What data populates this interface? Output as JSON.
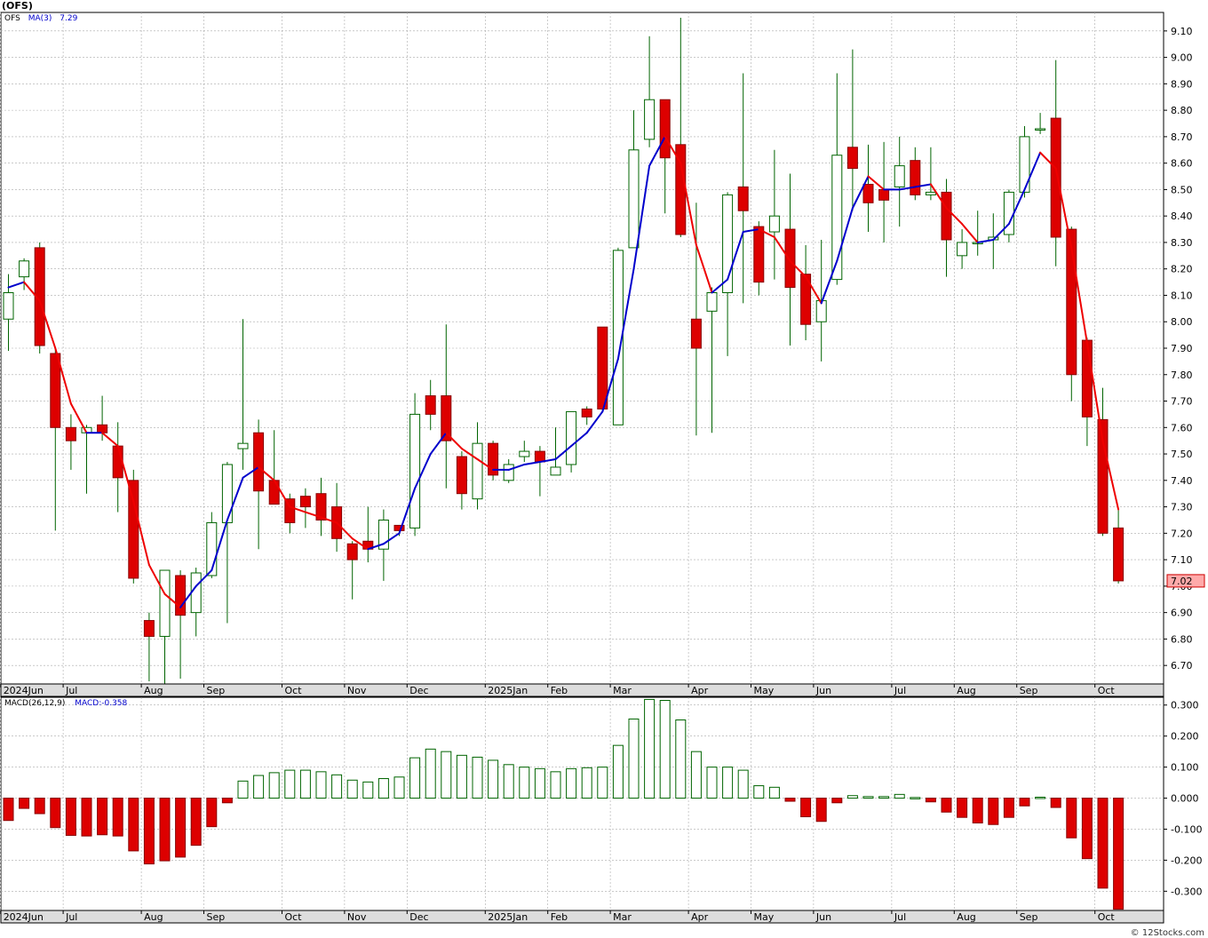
{
  "header": {
    "title": "(OFS)"
  },
  "footer": {
    "credit": "© 12Stocks.com"
  },
  "legends": {
    "price_symbol": "OFS",
    "price_ma_label": "MA(3)",
    "price_ma_value": "7.29",
    "macd_label": "MACD(26,12,9)",
    "macd_value": "MACD:-0.358"
  },
  "colors": {
    "up_candle": "#006400",
    "down_candle": "#dd0000",
    "ma_up": "#0000cc",
    "ma_down": "#ee0000",
    "grid": "#aaaaaa",
    "axis_band": "#dddddd",
    "last_price_box": "#ffaaaa"
  },
  "chart_data": [
    {
      "type": "candlestick",
      "ylim": [
        6.63,
        9.17
      ],
      "yticks": [
        "6.70",
        "6.80",
        "6.90",
        "7.00",
        "7.10",
        "7.20",
        "7.30",
        "7.40",
        "7.50",
        "7.60",
        "7.70",
        "7.80",
        "7.90",
        "8.00",
        "8.10",
        "8.20",
        "8.30",
        "8.40",
        "8.50",
        "8.60",
        "8.70",
        "8.80",
        "8.90",
        "9.00",
        "9.10"
      ],
      "last_price": "7.02",
      "month_labels": [
        {
          "label": "2024Jun",
          "week": 0
        },
        {
          "label": "Jul",
          "week": 4
        },
        {
          "label": "Aug",
          "week": 9
        },
        {
          "label": "Sep",
          "week": 13
        },
        {
          "label": "Oct",
          "week": 18
        },
        {
          "label": "Nov",
          "week": 22
        },
        {
          "label": "Dec",
          "week": 26
        },
        {
          "label": "2025Jan",
          "week": 31
        },
        {
          "label": "Feb",
          "week": 35
        },
        {
          "label": "Mar",
          "week": 39
        },
        {
          "label": "Apr",
          "week": 44
        },
        {
          "label": "May",
          "week": 48
        },
        {
          "label": "Jun",
          "week": 52
        },
        {
          "label": "Jul",
          "week": 57
        },
        {
          "label": "Aug",
          "week": 61
        },
        {
          "label": "Sep",
          "week": 65
        },
        {
          "label": "Oct",
          "week": 70
        }
      ],
      "candles": [
        {
          "o": 8.01,
          "h": 8.18,
          "l": 7.89,
          "c": 8.11
        },
        {
          "o": 8.17,
          "h": 8.24,
          "l": 8.12,
          "c": 8.23
        },
        {
          "o": 8.28,
          "h": 8.3,
          "l": 7.88,
          "c": 7.91
        },
        {
          "o": 7.88,
          "h": 7.9,
          "l": 7.21,
          "c": 7.6
        },
        {
          "o": 7.6,
          "h": 7.65,
          "l": 7.44,
          "c": 7.55
        },
        {
          "o": 7.58,
          "h": 7.61,
          "l": 7.35,
          "c": 7.6
        },
        {
          "o": 7.61,
          "h": 7.72,
          "l": 7.55,
          "c": 7.58
        },
        {
          "o": 7.53,
          "h": 7.62,
          "l": 7.28,
          "c": 7.41
        },
        {
          "o": 7.4,
          "h": 7.44,
          "l": 7.01,
          "c": 7.03
        },
        {
          "o": 6.87,
          "h": 6.9,
          "l": 6.64,
          "c": 6.81
        },
        {
          "o": 6.81,
          "h": 7.06,
          "l": 6.63,
          "c": 7.06
        },
        {
          "o": 7.04,
          "h": 7.06,
          "l": 6.65,
          "c": 6.89
        },
        {
          "o": 6.9,
          "h": 7.07,
          "l": 6.81,
          "c": 7.05
        },
        {
          "o": 7.04,
          "h": 7.28,
          "l": 7.03,
          "c": 7.24
        },
        {
          "o": 7.24,
          "h": 7.47,
          "l": 6.86,
          "c": 7.46
        },
        {
          "o": 7.52,
          "h": 8.01,
          "l": 7.44,
          "c": 7.54
        },
        {
          "o": 7.58,
          "h": 7.63,
          "l": 7.14,
          "c": 7.36
        },
        {
          "o": 7.4,
          "h": 7.59,
          "l": 7.31,
          "c": 7.31
        },
        {
          "o": 7.33,
          "h": 7.35,
          "l": 7.2,
          "c": 7.24
        },
        {
          "o": 7.34,
          "h": 7.37,
          "l": 7.22,
          "c": 7.3
        },
        {
          "o": 7.35,
          "h": 7.41,
          "l": 7.19,
          "c": 7.25
        },
        {
          "o": 7.3,
          "h": 7.39,
          "l": 7.13,
          "c": 7.18
        },
        {
          "o": 7.16,
          "h": 7.17,
          "l": 6.95,
          "c": 7.1
        },
        {
          "o": 7.17,
          "h": 7.3,
          "l": 7.09,
          "c": 7.14
        },
        {
          "o": 7.14,
          "h": 7.29,
          "l": 7.02,
          "c": 7.25
        },
        {
          "o": 7.23,
          "h": 7.23,
          "l": 7.19,
          "c": 7.21
        },
        {
          "o": 7.22,
          "h": 7.73,
          "l": 7.19,
          "c": 7.65
        },
        {
          "o": 7.72,
          "h": 7.78,
          "l": 7.59,
          "c": 7.65
        },
        {
          "o": 7.72,
          "h": 7.99,
          "l": 7.37,
          "c": 7.55
        },
        {
          "o": 7.49,
          "h": 7.51,
          "l": 7.29,
          "c": 7.35
        },
        {
          "o": 7.33,
          "h": 7.62,
          "l": 7.29,
          "c": 7.54
        },
        {
          "o": 7.54,
          "h": 7.55,
          "l": 7.4,
          "c": 7.42
        },
        {
          "o": 7.4,
          "h": 7.48,
          "l": 7.39,
          "c": 7.46
        },
        {
          "o": 7.49,
          "h": 7.55,
          "l": 7.47,
          "c": 7.51
        },
        {
          "o": 7.51,
          "h": 7.53,
          "l": 7.34,
          "c": 7.47
        },
        {
          "o": 7.42,
          "h": 7.6,
          "l": 7.42,
          "c": 7.45
        },
        {
          "o": 7.46,
          "h": 7.66,
          "l": 7.43,
          "c": 7.66
        },
        {
          "o": 7.67,
          "h": 7.68,
          "l": 7.61,
          "c": 7.64
        },
        {
          "o": 7.98,
          "h": 7.98,
          "l": 7.66,
          "c": 7.67
        },
        {
          "o": 7.61,
          "h": 8.28,
          "l": 7.61,
          "c": 8.27
        },
        {
          "o": 8.28,
          "h": 8.8,
          "l": 8.28,
          "c": 8.65
        },
        {
          "o": 8.69,
          "h": 9.08,
          "l": 8.66,
          "c": 8.84
        },
        {
          "o": 8.84,
          "h": 8.84,
          "l": 8.41,
          "c": 8.62
        },
        {
          "o": 8.67,
          "h": 9.15,
          "l": 8.32,
          "c": 8.33
        },
        {
          "o": 8.01,
          "h": 8.45,
          "l": 7.57,
          "c": 7.9
        },
        {
          "o": 8.04,
          "h": 8.13,
          "l": 7.58,
          "c": 8.11
        },
        {
          "o": 8.11,
          "h": 8.49,
          "l": 7.87,
          "c": 8.48
        },
        {
          "o": 8.51,
          "h": 8.94,
          "l": 8.07,
          "c": 8.42
        },
        {
          "o": 8.36,
          "h": 8.38,
          "l": 8.1,
          "c": 8.15
        },
        {
          "o": 8.34,
          "h": 8.65,
          "l": 8.16,
          "c": 8.4
        },
        {
          "o": 8.35,
          "h": 8.56,
          "l": 7.91,
          "c": 8.13
        },
        {
          "o": 8.18,
          "h": 8.29,
          "l": 7.93,
          "c": 7.99
        },
        {
          "o": 8.0,
          "h": 8.31,
          "l": 7.85,
          "c": 8.08
        },
        {
          "o": 8.16,
          "h": 8.94,
          "l": 8.14,
          "c": 8.63
        },
        {
          "o": 8.66,
          "h": 9.03,
          "l": 8.42,
          "c": 8.58
        },
        {
          "o": 8.52,
          "h": 8.67,
          "l": 8.34,
          "c": 8.45
        },
        {
          "o": 8.5,
          "h": 8.68,
          "l": 8.3,
          "c": 8.46
        },
        {
          "o": 8.51,
          "h": 8.7,
          "l": 8.36,
          "c": 8.59
        },
        {
          "o": 8.61,
          "h": 8.66,
          "l": 8.46,
          "c": 8.48
        },
        {
          "o": 8.48,
          "h": 8.66,
          "l": 8.46,
          "c": 8.49
        },
        {
          "o": 8.49,
          "h": 8.54,
          "l": 8.17,
          "c": 8.31
        },
        {
          "o": 8.25,
          "h": 8.35,
          "l": 8.2,
          "c": 8.3
        },
        {
          "o": 8.3,
          "h": 8.42,
          "l": 8.25,
          "c": 8.3
        },
        {
          "o": 8.31,
          "h": 8.41,
          "l": 8.2,
          "c": 8.32
        },
        {
          "o": 8.33,
          "h": 8.5,
          "l": 8.3,
          "c": 8.49
        },
        {
          "o": 8.49,
          "h": 8.74,
          "l": 8.47,
          "c": 8.7
        },
        {
          "o": 8.73,
          "h": 8.79,
          "l": 8.71,
          "c": 8.73
        },
        {
          "o": 8.77,
          "h": 8.99,
          "l": 8.21,
          "c": 8.32
        },
        {
          "o": 8.35,
          "h": 8.36,
          "l": 7.7,
          "c": 7.8
        },
        {
          "o": 7.93,
          "h": 7.94,
          "l": 7.53,
          "c": 7.64
        },
        {
          "o": 7.63,
          "h": 7.75,
          "l": 7.19,
          "c": 7.2
        },
        {
          "o": 7.22,
          "h": 7.29,
          "l": 7.01,
          "c": 7.02
        }
      ],
      "ma3": [
        8.13,
        8.15,
        8.08,
        7.9,
        7.69,
        7.58,
        7.58,
        7.53,
        7.32,
        7.08,
        6.97,
        6.92,
        7.0,
        7.06,
        7.25,
        7.41,
        7.45,
        7.4,
        7.3,
        7.28,
        7.26,
        7.24,
        7.18,
        7.14,
        7.16,
        7.2,
        7.37,
        7.5,
        7.58,
        7.52,
        7.48,
        7.44,
        7.44,
        7.46,
        7.47,
        7.48,
        7.53,
        7.58,
        7.66,
        7.86,
        8.2,
        8.59,
        8.7,
        8.6,
        8.29,
        8.11,
        8.16,
        8.34,
        8.35,
        8.32,
        8.23,
        8.17,
        8.07,
        8.23,
        8.43,
        8.55,
        8.5,
        8.5,
        8.51,
        8.52,
        8.43,
        8.37,
        8.3,
        8.31,
        8.37,
        8.5,
        8.64,
        8.58,
        8.28,
        7.92,
        7.55,
        7.29
      ]
    },
    {
      "type": "bar",
      "title": "MACD(26,12,9)",
      "ylim": [
        -0.362,
        0.325
      ],
      "yticks": [
        "-0.300",
        "-0.200",
        "-0.100",
        "0.000",
        "0.100",
        "0.200",
        "0.300"
      ],
      "values": [
        -0.072,
        -0.033,
        -0.05,
        -0.095,
        -0.12,
        -0.122,
        -0.118,
        -0.122,
        -0.17,
        -0.212,
        -0.202,
        -0.19,
        -0.152,
        -0.092,
        -0.015,
        0.055,
        0.073,
        0.082,
        0.09,
        0.09,
        0.085,
        0.075,
        0.058,
        0.052,
        0.063,
        0.068,
        0.13,
        0.158,
        0.15,
        0.138,
        0.132,
        0.122,
        0.108,
        0.1,
        0.095,
        0.085,
        0.095,
        0.098,
        0.1,
        0.17,
        0.255,
        0.318,
        0.315,
        0.252,
        0.15,
        0.1,
        0.1,
        0.09,
        0.04,
        0.035,
        -0.01,
        -0.06,
        -0.075,
        -0.015,
        0.008,
        0.005,
        0.005,
        0.012,
        0.002,
        -0.012,
        -0.045,
        -0.062,
        -0.08,
        -0.085,
        -0.062,
        -0.025,
        0.003,
        -0.03,
        -0.128,
        -0.195,
        -0.29,
        -0.358
      ]
    }
  ]
}
